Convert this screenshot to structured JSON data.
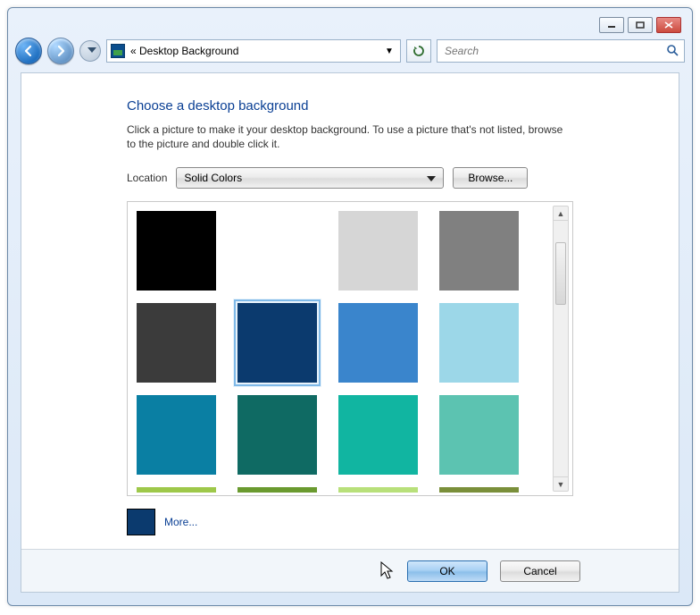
{
  "breadcrumb": "«  Desktop Background",
  "search": {
    "placeholder": "Search"
  },
  "heading": "Choose a desktop background",
  "instructions": "Click a picture to make it your desktop background. To use a picture that's not listed, browse to the picture and double click it.",
  "location_label": "Location",
  "location_value": "Solid Colors",
  "browse_label": "Browse...",
  "swatches": {
    "row1": [
      "#000000",
      "#ffffff",
      "#d6d6d6",
      "#808080"
    ],
    "row2": [
      "#3b3b3b",
      "#0b3a6e",
      "#3a85cc",
      "#9cd7e8"
    ],
    "row3": [
      "#0a7fa3",
      "#0f6a63",
      "#11b5a1",
      "#5cc3b1"
    ],
    "partial": [
      "#9ec84a",
      "#6a9a2f",
      "#b8e07a",
      "#7a8f3a"
    ]
  },
  "selected_color": "#0b3a6e",
  "more_label": "More...",
  "ok_label": "OK",
  "cancel_label": "Cancel"
}
